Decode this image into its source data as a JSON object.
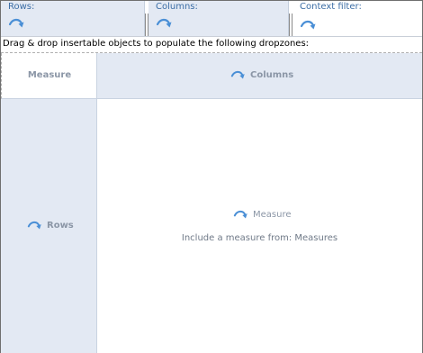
{
  "axis_bar": {
    "rows_label": "Rows:",
    "columns_label": "Columns:",
    "context_filter_label": "Context filter:"
  },
  "instruction": "Drag & drop insertable objects to populate the following dropzones:",
  "grid": {
    "corner_label": "Measure",
    "columns_label": "Columns",
    "rows_label": "Rows",
    "measure_drop_label": "Measure",
    "measure_hint": "Include a measure from: Measures"
  },
  "icons": {
    "drop_arrow": "curved-arrow-icon"
  },
  "colors": {
    "zone_background": "#e3e9f3",
    "axis_label": "#3c6ea6",
    "drop_arrow": "#4a8fd6",
    "dropzone_text": "#8b96a6"
  }
}
